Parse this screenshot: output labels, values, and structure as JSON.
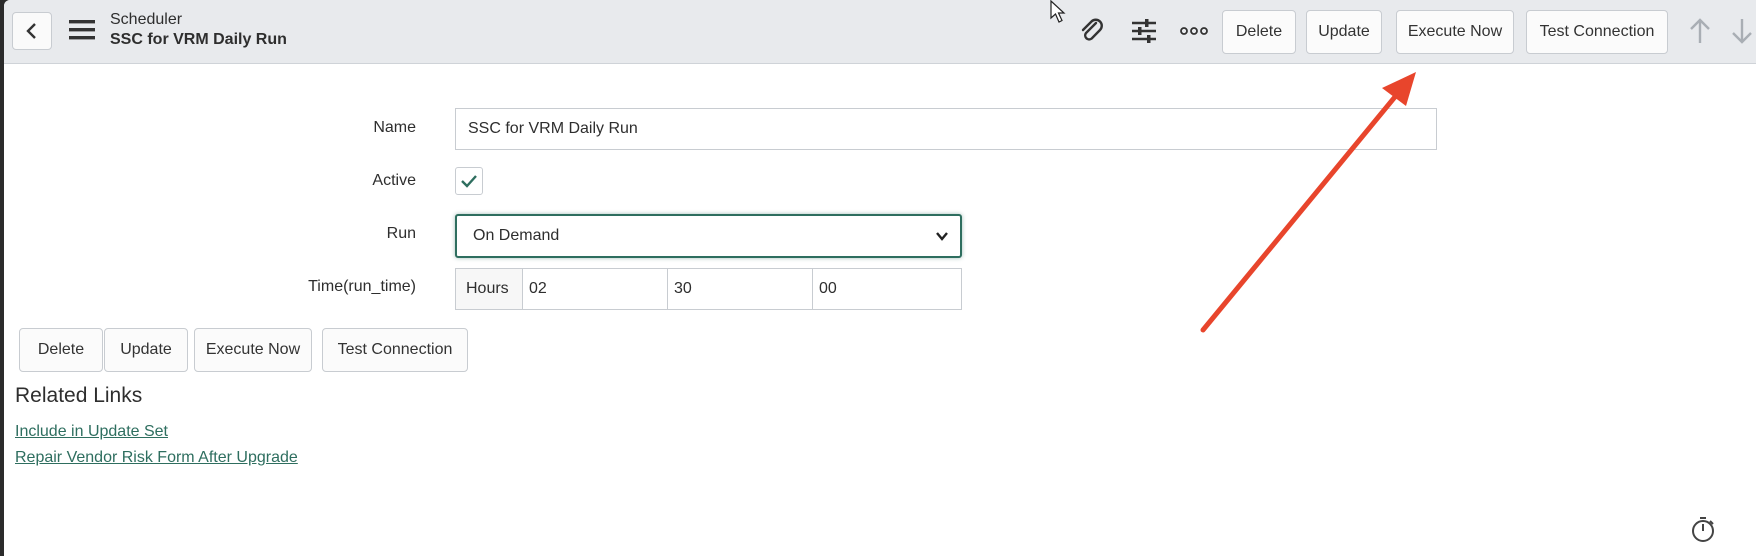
{
  "header": {
    "title": "Scheduler",
    "subtitle": "SSC for VRM Daily Run",
    "buttons": {
      "delete": "Delete",
      "update": "Update",
      "execute_now": "Execute Now",
      "test_connection": "Test Connection"
    },
    "icons": [
      "back-icon",
      "menu-icon",
      "paperclip-icon",
      "sliders-icon",
      "more-icon",
      "arrow-up-icon",
      "arrow-down-icon"
    ]
  },
  "form": {
    "name": {
      "label": "Name",
      "value": "SSC for VRM Daily Run"
    },
    "active": {
      "label": "Active",
      "checked": true
    },
    "run": {
      "label": "Run",
      "value": "On Demand"
    },
    "time": {
      "label": "Time(run_time)",
      "unit": "Hours",
      "hours": "02",
      "minutes": "30",
      "seconds": "00"
    }
  },
  "actions": {
    "delete": "Delete",
    "update": "Update",
    "execute_now": "Execute Now",
    "test_connection": "Test Connection"
  },
  "related_links": {
    "title": "Related Links",
    "links": [
      "Include in Update Set",
      "Repair Vendor Risk Form After Upgrade"
    ]
  },
  "colors": {
    "accent": "#2e6e5f",
    "annotation_arrow": "#e8452c",
    "header_bg": "#e8eaed"
  }
}
